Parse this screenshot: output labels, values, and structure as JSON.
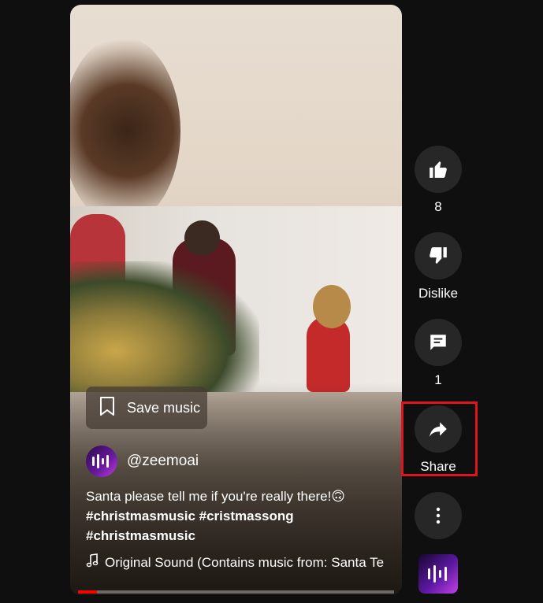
{
  "save_music": {
    "label": "Save music"
  },
  "channel": {
    "handle": "@zeemoai"
  },
  "description": {
    "text": "Santa please tell me if you're really there!🙃",
    "hashtags": [
      "#christmasmusic #cristmassong",
      "#christmasmusic"
    ]
  },
  "sound": {
    "label": "Original Sound (Contains music from: Santa Te"
  },
  "progress": {
    "fraction": 0.06,
    "color": "#ff0000"
  },
  "actions": {
    "like_count": "8",
    "dislike_label": "Dislike",
    "comment_count": "1",
    "share_label": "Share"
  },
  "colors": {
    "highlight": "#e0141e",
    "button_bg": "#272727",
    "background": "#0f0f0f"
  },
  "icons": [
    "thumb-up-icon",
    "thumb-down-icon",
    "comment-icon",
    "share-arrow-icon",
    "more-vert-icon",
    "bookmark-icon",
    "music-note-icon",
    "waveform-logo-icon"
  ]
}
